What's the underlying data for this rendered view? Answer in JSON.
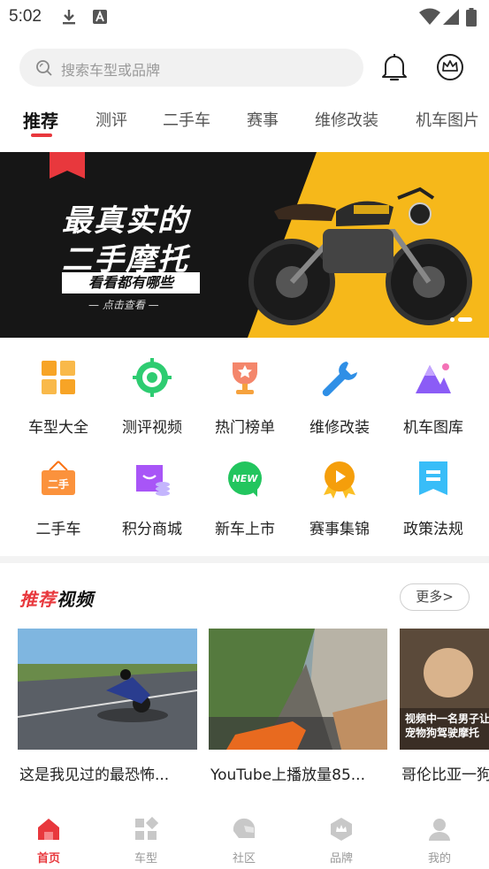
{
  "status_bar": {
    "time": "5:02"
  },
  "search": {
    "placeholder": "搜索车型或品牌"
  },
  "tabs": [
    {
      "label": "推荐",
      "active": true
    },
    {
      "label": "测评"
    },
    {
      "label": "二手车"
    },
    {
      "label": "赛事"
    },
    {
      "label": "维修改装"
    },
    {
      "label": "机车图片"
    }
  ],
  "banner": {
    "line1": "最真实的",
    "line2": "二手摩托",
    "line3": "看看都有哪些",
    "line4": "— 点击查看 —",
    "slide_count": 2,
    "active_slide": 2
  },
  "grid": [
    {
      "label": "车型大全",
      "icon": "car-model-grid-icon"
    },
    {
      "label": "测评视频",
      "icon": "review-video-icon"
    },
    {
      "label": "热门榜单",
      "icon": "trophy-icon"
    },
    {
      "label": "维修改装",
      "icon": "wrench-icon"
    },
    {
      "label": "机车图库",
      "icon": "mountain-gallery-icon"
    },
    {
      "label": "二手车",
      "icon": "second-hand-tag-icon",
      "tag": "二手"
    },
    {
      "label": "积分商城",
      "icon": "points-mall-icon"
    },
    {
      "label": "新车上市",
      "icon": "new-car-icon",
      "tag": "NEW"
    },
    {
      "label": "赛事集锦",
      "icon": "race-medal-icon"
    },
    {
      "label": "政策法规",
      "icon": "policy-doc-icon"
    }
  ],
  "recommended": {
    "title_red": "推荐",
    "title_black": "视频",
    "more_label": "更多>",
    "videos": [
      {
        "title": "这是我见过的最恐怖..."
      },
      {
        "title": "YouTube上播放量85..."
      },
      {
        "title": "哥伦比亚一狗",
        "caption": "视频中一名男子让宠物狗驾驶摩托"
      }
    ]
  },
  "bottom_nav": [
    {
      "label": "首页",
      "active": true,
      "icon": "home-icon"
    },
    {
      "label": "车型",
      "icon": "car-model-icon"
    },
    {
      "label": "社区",
      "icon": "helmet-icon"
    },
    {
      "label": "品牌",
      "icon": "brand-badge-icon"
    },
    {
      "label": "我的",
      "icon": "profile-icon"
    }
  ],
  "colors": {
    "accent": "#e8383d",
    "banner_yellow": "#f6b81a",
    "inactive": "#999999"
  }
}
